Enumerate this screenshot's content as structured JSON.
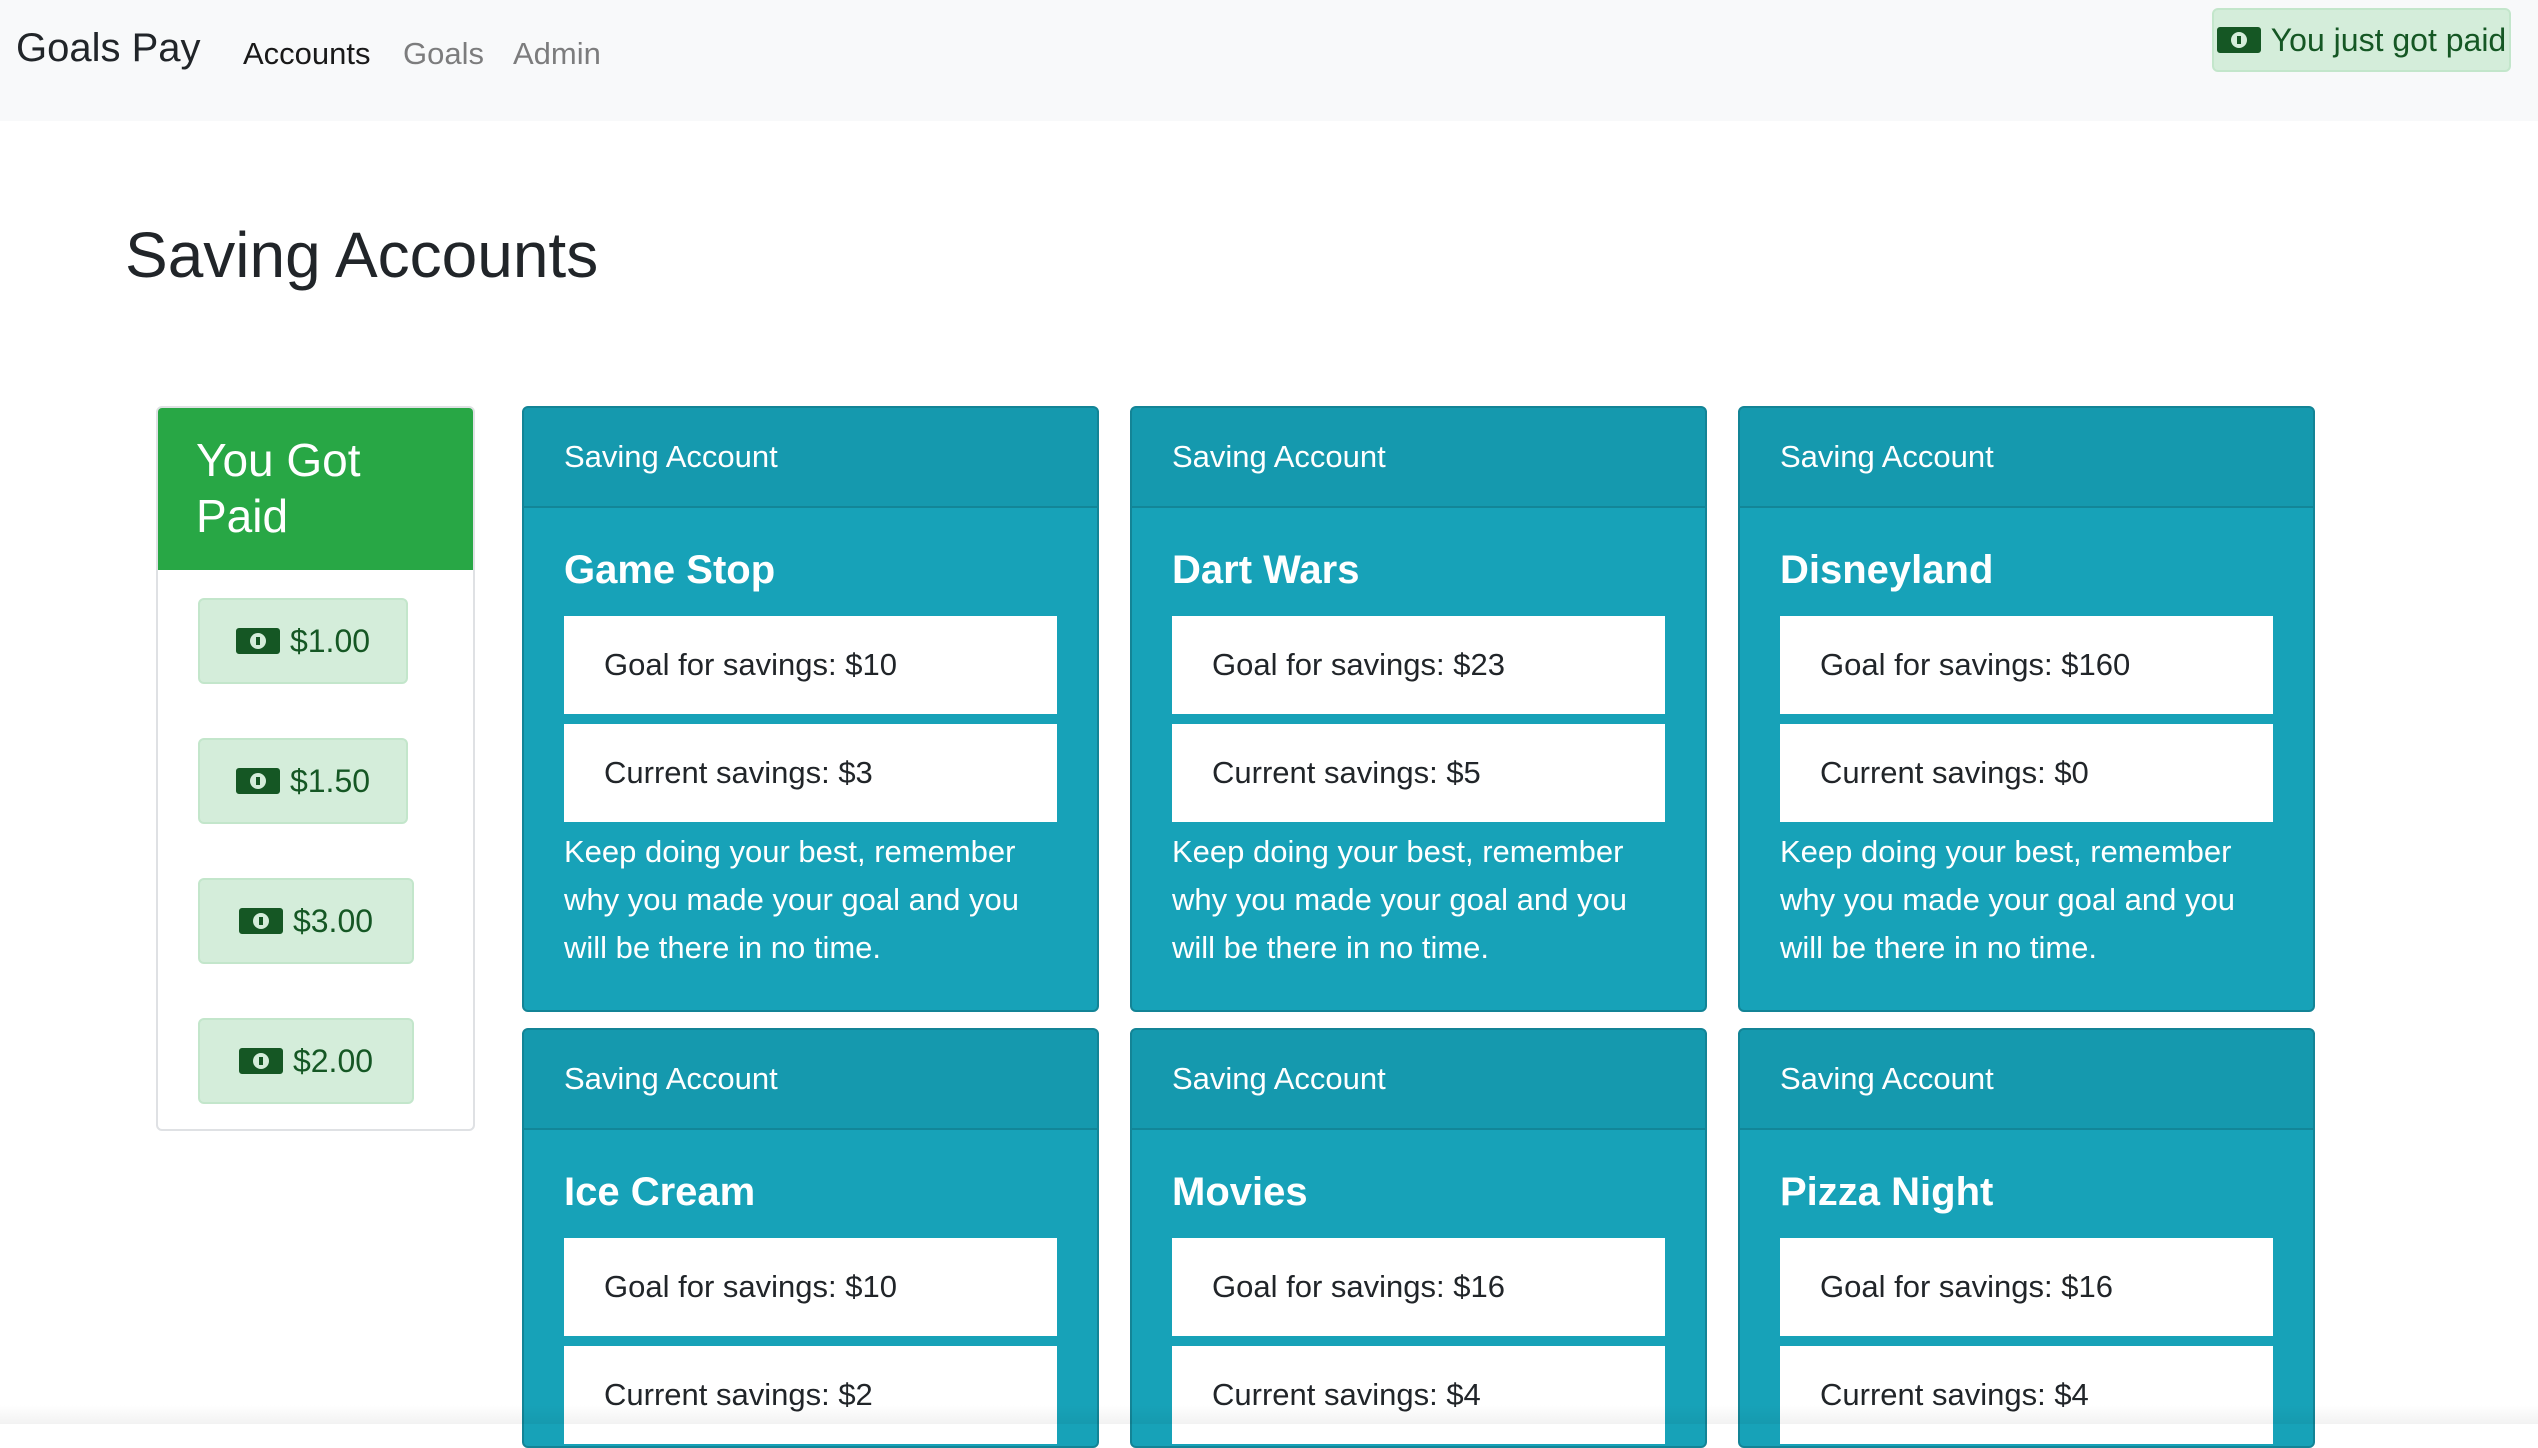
{
  "navbar": {
    "brand": "Goals Pay",
    "links": [
      {
        "label": "Accounts",
        "active": true
      },
      {
        "label": "Goals",
        "active": false
      },
      {
        "label": "Admin",
        "active": false
      }
    ],
    "paid_button": {
      "label": "You just got paid",
      "icon": "money-bill-icon"
    }
  },
  "page": {
    "title": "Saving Accounts"
  },
  "paid_panel": {
    "title": "You Got Paid",
    "amounts": [
      "$1.00",
      "$1.50",
      "$3.00",
      "$2.00"
    ],
    "icon": "money-bill-icon"
  },
  "cards": [
    {
      "header": "Saving Account",
      "title": "Game Stop",
      "goal": "Goal for savings: $10",
      "current": "Current savings: $3",
      "text": "Keep doing your best, remember why you made your goal and you will be there in no time."
    },
    {
      "header": "Saving Account",
      "title": "Dart Wars",
      "goal": "Goal for savings: $23",
      "current": "Current savings: $5",
      "text": "Keep doing your best, remember why you made your goal and you will be there in no time."
    },
    {
      "header": "Saving Account",
      "title": "Disneyland",
      "goal": "Goal for savings: $160",
      "current": "Current savings: $0",
      "text": "Keep doing your best, remember why you made your goal and you will be there in no time."
    },
    {
      "header": "Saving Account",
      "title": "Ice Cream",
      "goal": "Goal for savings: $10",
      "current": "Current savings: $2",
      "text": ""
    },
    {
      "header": "Saving Account",
      "title": "Movies",
      "goal": "Goal for savings: $16",
      "current": "Current savings: $4",
      "text": ""
    },
    {
      "header": "Saving Account",
      "title": "Pizza Night",
      "goal": "Goal for savings: $16",
      "current": "Current savings: $4",
      "text": ""
    }
  ],
  "colors": {
    "card": "#17a2b8",
    "paid_header": "#28a745",
    "paid_button_bg": "#d4edda",
    "paid_button_text": "#155724"
  }
}
